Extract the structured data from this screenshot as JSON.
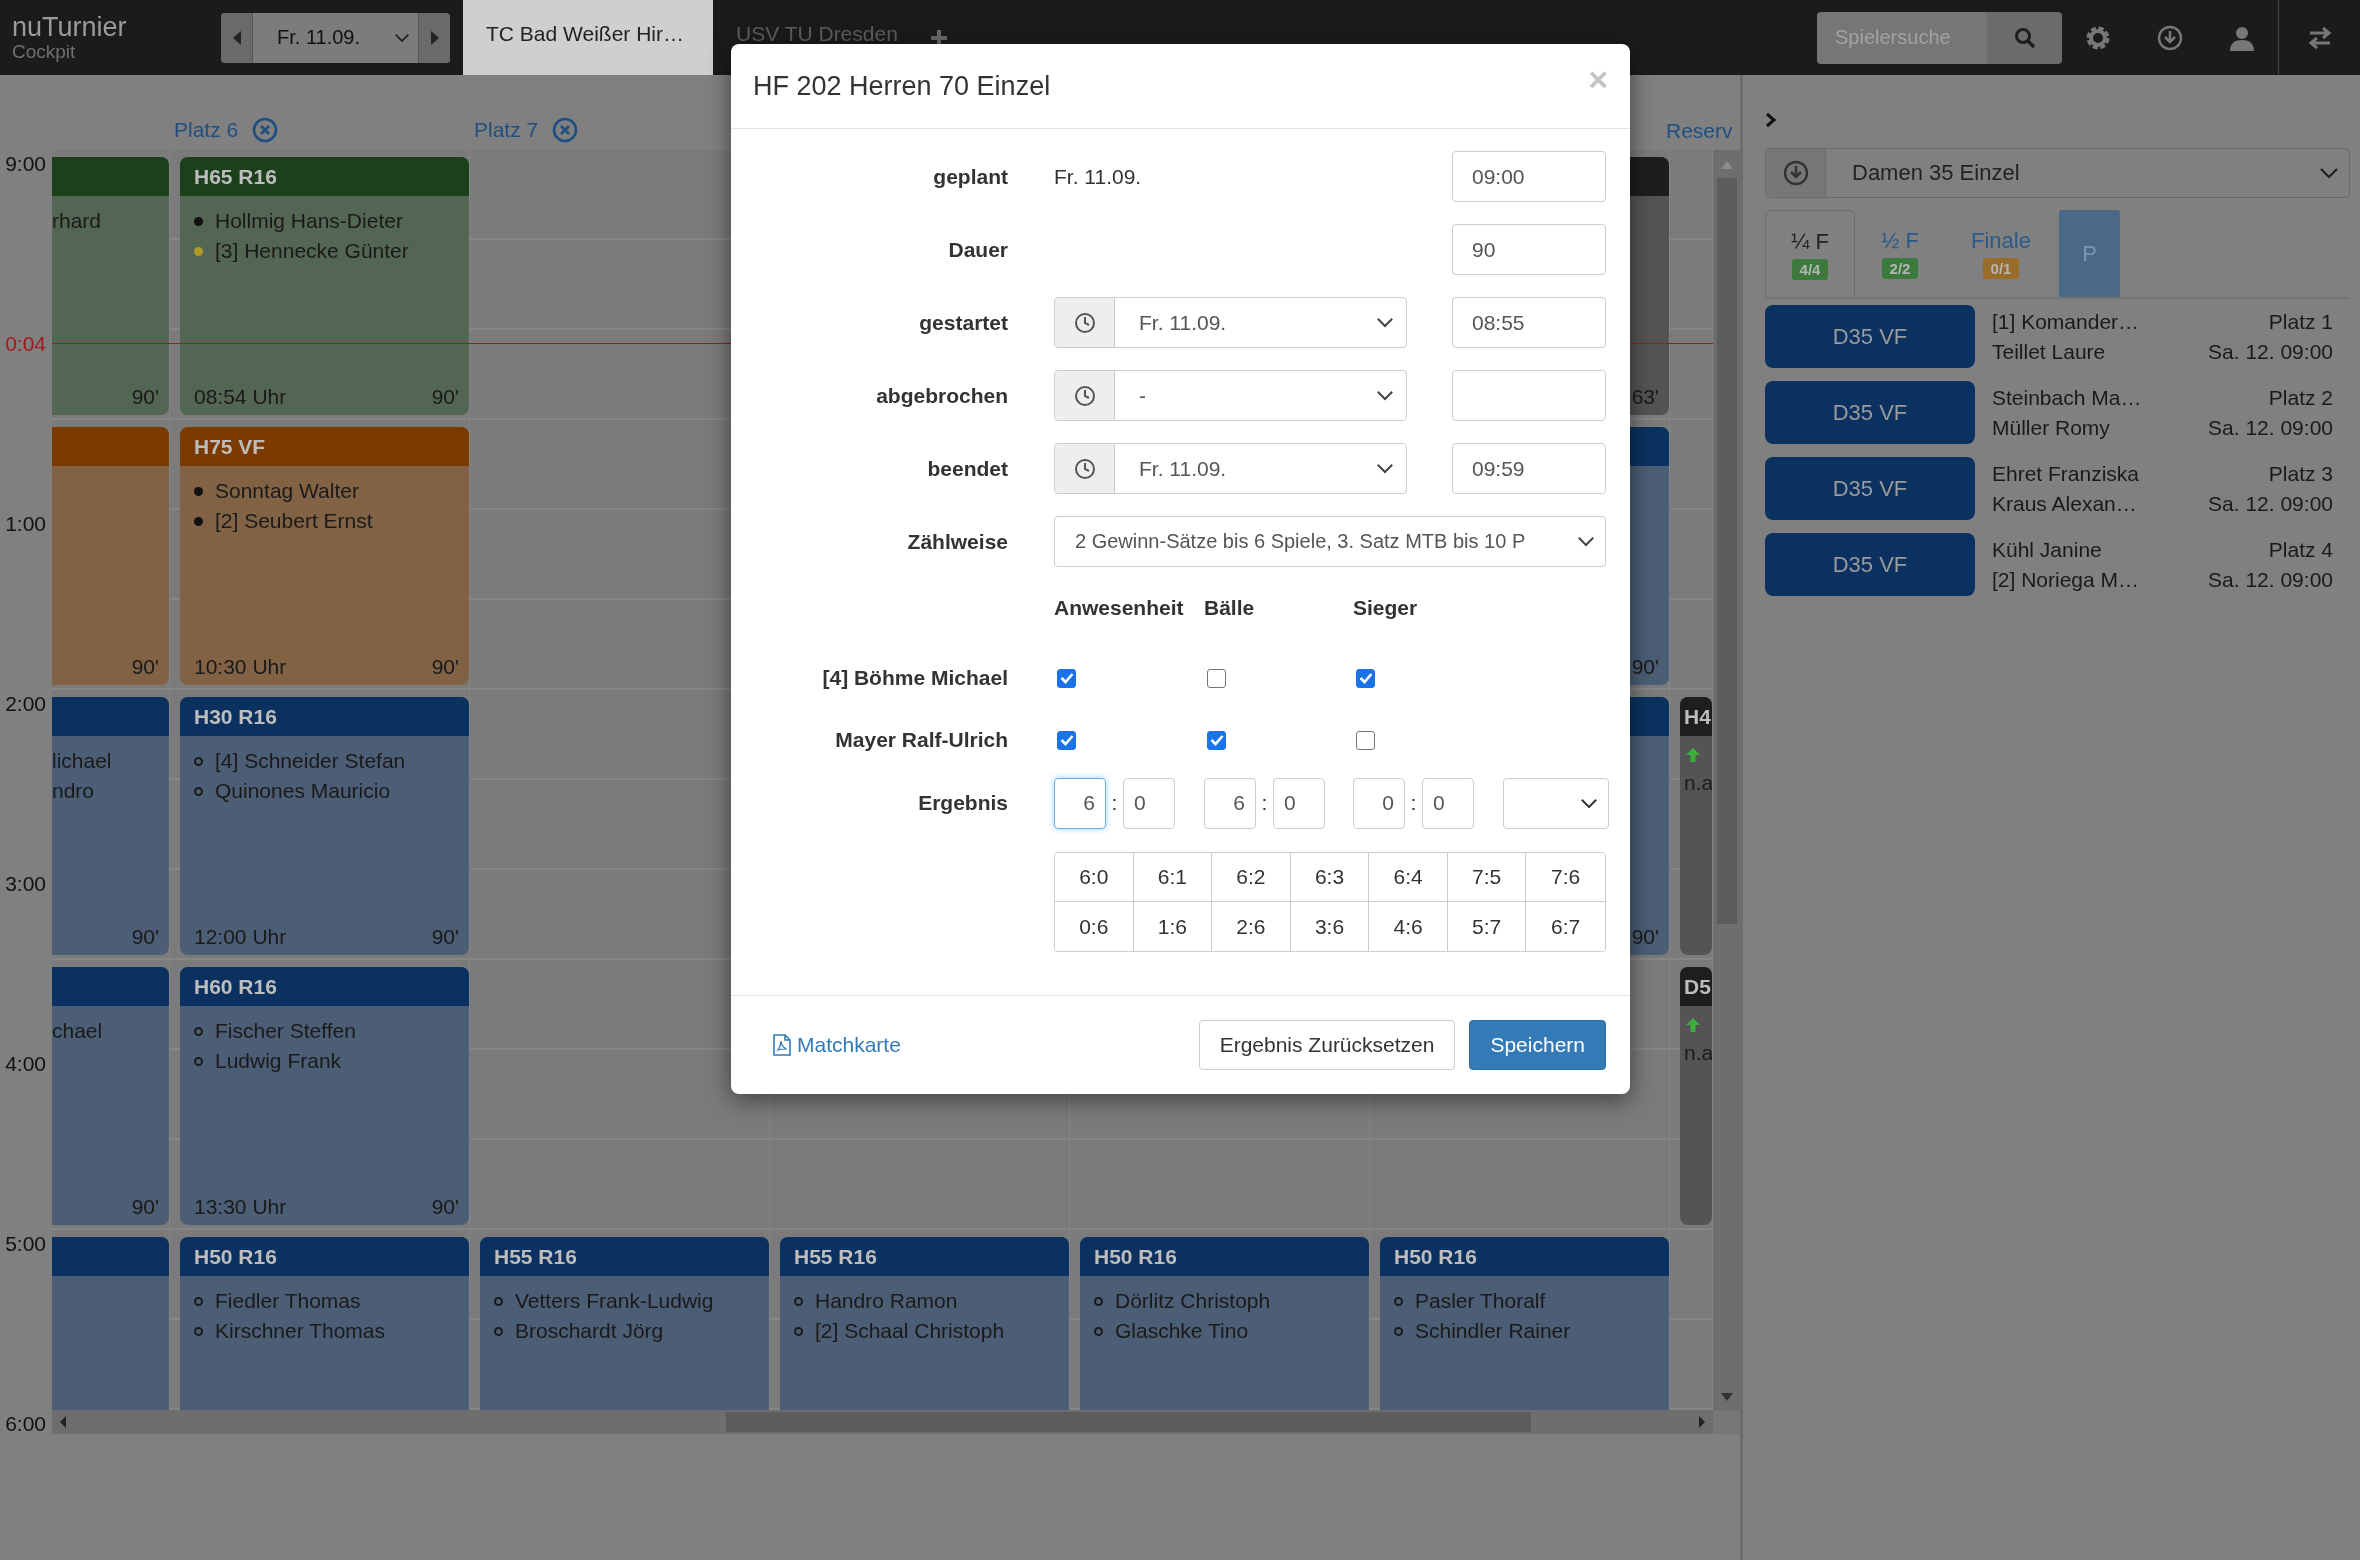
{
  "topbar": {
    "logo": "nuTurnier",
    "logo_sub": "Cockpit",
    "date": "Fr. 11.09.",
    "tabs": [
      {
        "label": "TC Bad Weißer Hir…",
        "selected": true
      },
      {
        "label": "USV TU Dresden",
        "selected": false
      }
    ],
    "search": {
      "placeholder": "Spielersuche"
    }
  },
  "schedule": {
    "hours": [
      {
        "label": "9:00",
        "kind": "hour"
      },
      {
        "label": "0:04",
        "kind": "now"
      },
      {
        "label": "1:00",
        "kind": "hour"
      },
      {
        "label": "2:00",
        "kind": "hour"
      },
      {
        "label": "3:00",
        "kind": "hour"
      },
      {
        "label": "4:00",
        "kind": "hour"
      },
      {
        "label": "5:00",
        "kind": "hour"
      },
      {
        "label": "6:00",
        "kind": "hour"
      }
    ],
    "columns": [
      {
        "kind": "partial",
        "cards": [
          {
            "kind": "match",
            "color": "#1b401b",
            "players": [
              {
                "name": "rhard"
              }
            ],
            "duration": "90'"
          },
          {
            "kind": "match",
            "color": "#7a3a00",
            "duration": "90'"
          },
          {
            "kind": "match",
            "color": "#0b3160",
            "players": [
              {
                "name": "lichael"
              },
              {
                "name": "ndro"
              }
            ],
            "duration": "90'"
          },
          {
            "kind": "match",
            "color": "#0b3160",
            "players": [
              {
                "name": "chael"
              }
            ],
            "duration": "90'"
          },
          {
            "kind": "match",
            "color": "#0b3160"
          }
        ]
      },
      {
        "kind": "court",
        "header": "Platz 6",
        "closable": true,
        "cards": [
          {
            "kind": "match",
            "color": "#1b401b",
            "title": "H65 R16",
            "players": [
              {
                "name": "Hollmig Hans-Dieter",
                "filled": true,
                "color": "#111111"
              },
              {
                "name": "[3] Hennecke Günter",
                "filled": true,
                "color": "#b09a2a"
              }
            ],
            "start": "08:54 Uhr",
            "duration": "90'"
          },
          {
            "kind": "match",
            "color": "#7a3a00",
            "title": "H75 VF",
            "players": [
              {
                "name": "Sonntag Walter",
                "filled": true,
                "color": "#111111"
              },
              {
                "name": "[2] Seubert Ernst",
                "filled": true,
                "color": "#111111"
              }
            ],
            "start": "10:30 Uhr",
            "duration": "90'"
          },
          {
            "kind": "match",
            "color": "#0b3160",
            "title": "H30 R16",
            "players": [
              {
                "name": "[4] Schneider Stefan",
                "filled": false
              },
              {
                "name": "Quinones Mauricio",
                "filled": false
              }
            ],
            "start": "12:00 Uhr",
            "duration": "90'"
          },
          {
            "kind": "match",
            "color": "#0b3160",
            "title": "H60 R16",
            "players": [
              {
                "name": "Fischer Steffen",
                "filled": false
              },
              {
                "name": "Ludwig Frank",
                "filled": false
              }
            ],
            "start": "13:30 Uhr",
            "duration": "90'"
          },
          {
            "kind": "match",
            "color": "#0b3160",
            "title": "H50 R16",
            "players": [
              {
                "name": "Fiedler Thomas",
                "filled": false
              },
              {
                "name": "Kirschner Thomas",
                "filled": false
              }
            ]
          }
        ]
      },
      {
        "kind": "court",
        "header": "Platz 7",
        "closable": true,
        "cards": [
          {
            "kind": "empty"
          },
          {
            "kind": "empty"
          },
          {
            "kind": "empty"
          },
          {
            "kind": "empty"
          },
          {
            "kind": "match",
            "color": "#0b3160",
            "title": "H55 R16",
            "players": [
              {
                "name": "Vetters Frank-Ludwig",
                "filled": false
              },
              {
                "name": "Broschardt Jörg",
                "filled": false
              }
            ]
          }
        ]
      },
      {
        "kind": "court",
        "cards": [
          {
            "kind": "empty"
          },
          {
            "kind": "empty"
          },
          {
            "kind": "empty"
          },
          {
            "kind": "empty"
          },
          {
            "kind": "match",
            "color": "#0b3160",
            "title": "H55 R16",
            "players": [
              {
                "name": "Handro Ramon",
                "filled": false
              },
              {
                "name": "[2] Schaal Christoph",
                "filled": false
              }
            ]
          }
        ]
      },
      {
        "kind": "court",
        "cards": [
          {
            "kind": "empty"
          },
          {
            "kind": "empty"
          },
          {
            "kind": "empty"
          },
          {
            "kind": "empty"
          },
          {
            "kind": "match",
            "color": "#0b3160",
            "title": "H50 R16",
            "players": [
              {
                "name": "Dörlitz Christoph",
                "filled": false
              },
              {
                "name": "Glaschke Tino",
                "filled": false
              }
            ]
          }
        ]
      },
      {
        "kind": "court",
        "cards": [
          {
            "kind": "match",
            "color": "#1e1e1e",
            "duration": "63'"
          },
          {
            "kind": "match",
            "color": "#0b3160",
            "duration": "90'"
          },
          {
            "kind": "match",
            "color": "#0b3160",
            "duration": "90'"
          },
          {
            "kind": "empty"
          },
          {
            "kind": "match",
            "color": "#0b3160",
            "title": "H50 R16",
            "players": [
              {
                "name": "Pasler Thoralf",
                "filled": false
              },
              {
                "name": "Schindler Rainer",
                "filled": false
              }
            ]
          }
        ]
      },
      {
        "kind": "narrow",
        "header": "Reserv",
        "closable": false,
        "cards": [
          {
            "kind": "empty"
          },
          {
            "kind": "empty"
          },
          {
            "kind": "reserve",
            "color": "#1e1e1e",
            "title": "H4",
            "players": [
              {
                "name": "n.a"
              }
            ]
          },
          {
            "kind": "reserve",
            "color": "#1e1e1e",
            "title": "D5",
            "players": [
              {
                "name": "n.a"
              }
            ]
          },
          {
            "kind": "empty"
          }
        ]
      }
    ]
  },
  "panel": {
    "competition": "Damen 35 Einzel",
    "tabs": [
      {
        "label": "¼ F",
        "badge": "4/4",
        "color": "#3b7a3b",
        "kind": "round",
        "selected": true
      },
      {
        "label": "½ F",
        "badge": "2/2",
        "color": "#3b7a3b",
        "kind": "round",
        "selected": false
      },
      {
        "label": "Finale",
        "badge": "0/1",
        "color": "#9a6c2a",
        "kind": "round",
        "selected": false
      },
      {
        "label": "P",
        "kind": "button",
        "selected": false
      }
    ],
    "matches": [
      {
        "code": "D35 VF",
        "players": [
          "[1] Komander…",
          "Teillet Laure"
        ],
        "court": "Platz 1",
        "time": "Sa. 12. 09:00"
      },
      {
        "code": "D35 VF",
        "players": [
          "Steinbach Ma…",
          "Müller Romy"
        ],
        "court": "Platz 2",
        "time": "Sa. 12. 09:00"
      },
      {
        "code": "D35 VF",
        "players": [
          "Ehret Franziska",
          "Kraus Alexan…"
        ],
        "court": "Platz 3",
        "time": "Sa. 12. 09:00"
      },
      {
        "code": "D35 VF",
        "players": [
          "Kühl Janine",
          "[2] Noriega M…"
        ],
        "court": "Platz 4",
        "time": "Sa. 12. 09:00"
      }
    ]
  },
  "modal": {
    "title": "HF 202 Herren 70 Einzel",
    "close": "×",
    "fields": [
      {
        "label": "geplant",
        "kind": "text",
        "date": "Fr. 11.09.",
        "time": "09:00"
      },
      {
        "label": "Dauer",
        "kind": "time",
        "time": "90"
      },
      {
        "label": "gestartet",
        "kind": "picker",
        "date": "Fr. 11.09.",
        "time": "08:55"
      },
      {
        "label": "abgebrochen",
        "kind": "picker",
        "date": "-"
      },
      {
        "label": "beendet",
        "kind": "picker",
        "date": "Fr. 11.09.",
        "time": "09:59"
      },
      {
        "label": "Zählweise",
        "kind": "select",
        "value": "2 Gewinn-Sätze bis 6 Spiele, 3. Satz MTB bis 10 P"
      }
    ],
    "attendance": {
      "columns": [
        "Anwesenheit",
        "Bälle",
        "Sieger"
      ],
      "players": [
        {
          "name": "[4] Böhme Michael",
          "checks": [
            true,
            false,
            true
          ]
        },
        {
          "name": "Mayer Ralf-Ulrich",
          "checks": [
            true,
            true,
            false
          ]
        }
      ]
    },
    "result": {
      "label": "Ergebnis",
      "sets": [
        {
          "home": "6",
          "sep": ":",
          "away": "0",
          "focused": true
        },
        {
          "home": "6",
          "sep": ":",
          "away": "0",
          "focused": false
        },
        {
          "home": "0",
          "sep": ":",
          "away": "0",
          "focused": false
        }
      ]
    },
    "quick_scores": [
      [
        "6:0",
        "6:1",
        "6:2",
        "6:3",
        "6:4",
        "7:5",
        "7:6"
      ],
      [
        "0:6",
        "1:6",
        "2:6",
        "3:6",
        "4:6",
        "5:7",
        "6:7"
      ]
    ],
    "footer": {
      "link": "Matchkarte",
      "buttons": [
        {
          "label": "Ergebnis Zurücksetzen",
          "kind": "default"
        },
        {
          "label": "Speichern",
          "kind": "primary"
        }
      ]
    }
  }
}
